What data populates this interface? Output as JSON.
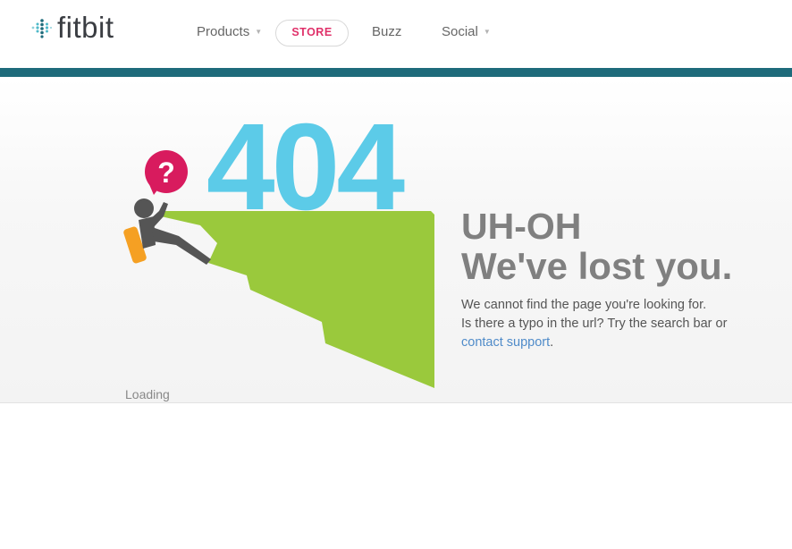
{
  "header": {
    "logo_text": "fitbit",
    "nav": {
      "products": "Products",
      "store": "STORE",
      "buzz": "Buzz",
      "social": "Social"
    }
  },
  "hero": {
    "code": "404",
    "heading_1": "UH-OH",
    "heading_2": "We've lost you.",
    "line_1": "We cannot find the page you're looking for.",
    "line_2": "Is there a typo in the url? Try the search bar or",
    "link_text": "contact support",
    "line_end": ".",
    "question_mark": "?",
    "loading": "Loading"
  },
  "colors": {
    "brand_teal": "#1e6b7b",
    "store_pink": "#e0316a",
    "code_blue": "#5ccbe8",
    "cliff_green": "#9ac93c",
    "bubble_pink": "#d81b5e",
    "backpack_orange": "#f5a023",
    "link_blue": "#4f8bc9"
  },
  "icons": [
    "fitbit-dots-logo-icon",
    "caret-down-icon",
    "question-bubble-icon",
    "climber-figure"
  ]
}
